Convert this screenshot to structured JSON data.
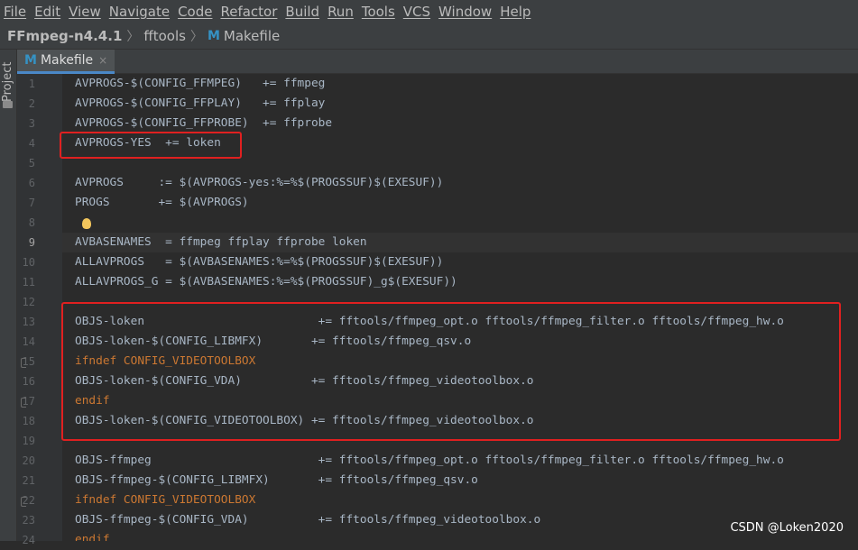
{
  "menu": [
    "File",
    "Edit",
    "View",
    "Navigate",
    "Code",
    "Refactor",
    "Build",
    "Run",
    "Tools",
    "VCS",
    "Window",
    "Help"
  ],
  "breadcrumb": {
    "project": "FFmpeg-n4.4.1",
    "folder": "fftools",
    "file": "Makefile",
    "file_icon": "makefile-m-icon"
  },
  "sidebar": {
    "project_label": "Project"
  },
  "tab": {
    "label": "Makefile",
    "close": "×"
  },
  "line_numbers": [
    "1",
    "2",
    "3",
    "4",
    "5",
    "6",
    "7",
    "8",
    "9",
    "10",
    "11",
    "12",
    "13",
    "14",
    "15",
    "16",
    "17",
    "18",
    "19",
    "20",
    "21",
    "22",
    "23",
    "24"
  ],
  "code": [
    {
      "num": "1",
      "text": "AVPROGS-$(CONFIG_FFMPEG)   += ffmpeg"
    },
    {
      "num": "2",
      "text": "AVPROGS-$(CONFIG_FFPLAY)   += ffplay"
    },
    {
      "num": "3",
      "text": "AVPROGS-$(CONFIG_FFPROBE)  += ffprobe"
    },
    {
      "num": "4",
      "text": "AVPROGS-YES  += loken"
    },
    {
      "num": "5",
      "text": ""
    },
    {
      "num": "6",
      "text": "AVPROGS     := $(AVPROGS-yes:%=%$(PROGSSUF)$(EXESUF))"
    },
    {
      "num": "7",
      "text": "PROGS       += $(AVPROGS)"
    },
    {
      "num": "8",
      "text": ""
    },
    {
      "num": "9",
      "text": "AVBASENAMES  = ffmpeg ffplay ffprobe loken"
    },
    {
      "num": "10",
      "text": "ALLAVPROGS   = $(AVBASENAMES:%=%$(PROGSSUF)$(EXESUF))"
    },
    {
      "num": "11",
      "text": "ALLAVPROGS_G = $(AVBASENAMES:%=%$(PROGSSUF)_g$(EXESUF))"
    },
    {
      "num": "12",
      "text": ""
    },
    {
      "num": "13",
      "text": "OBJS-loken                         += fftools/ffmpeg_opt.o fftools/ffmpeg_filter.o fftools/ffmpeg_hw.o"
    },
    {
      "num": "14",
      "text": "OBJS-loken-$(CONFIG_LIBMFX)       += fftools/ffmpeg_qsv.o"
    },
    {
      "num": "15",
      "text": "ifndef CONFIG_VIDEOTOOLBOX"
    },
    {
      "num": "16",
      "text": "OBJS-loken-$(CONFIG_VDA)          += fftools/ffmpeg_videotoolbox.o"
    },
    {
      "num": "17",
      "text": "endif"
    },
    {
      "num": "18",
      "text": "OBJS-loken-$(CONFIG_VIDEOTOOLBOX) += fftools/ffmpeg_videotoolbox.o"
    },
    {
      "num": "19",
      "text": ""
    },
    {
      "num": "20",
      "text": "OBJS-ffmpeg                        += fftools/ffmpeg_opt.o fftools/ffmpeg_filter.o fftools/ffmpeg_hw.o"
    },
    {
      "num": "21",
      "text": "OBJS-ffmpeg-$(CONFIG_LIBMFX)       += fftools/ffmpeg_qsv.o"
    },
    {
      "num": "22",
      "text": "ifndef CONFIG_VIDEOTOOLBOX"
    },
    {
      "num": "23",
      "text": "OBJS-ffmpeg-$(CONFIG_VDA)          += fftools/ffmpeg_videotoolbox.o"
    },
    {
      "num": "24",
      "text": "endif"
    }
  ],
  "watermark": "CSDN @Loken2020",
  "colors": {
    "annotation_box": "#e02020",
    "keyword": "#cc7832",
    "tab_accent": "#4a88c7"
  }
}
